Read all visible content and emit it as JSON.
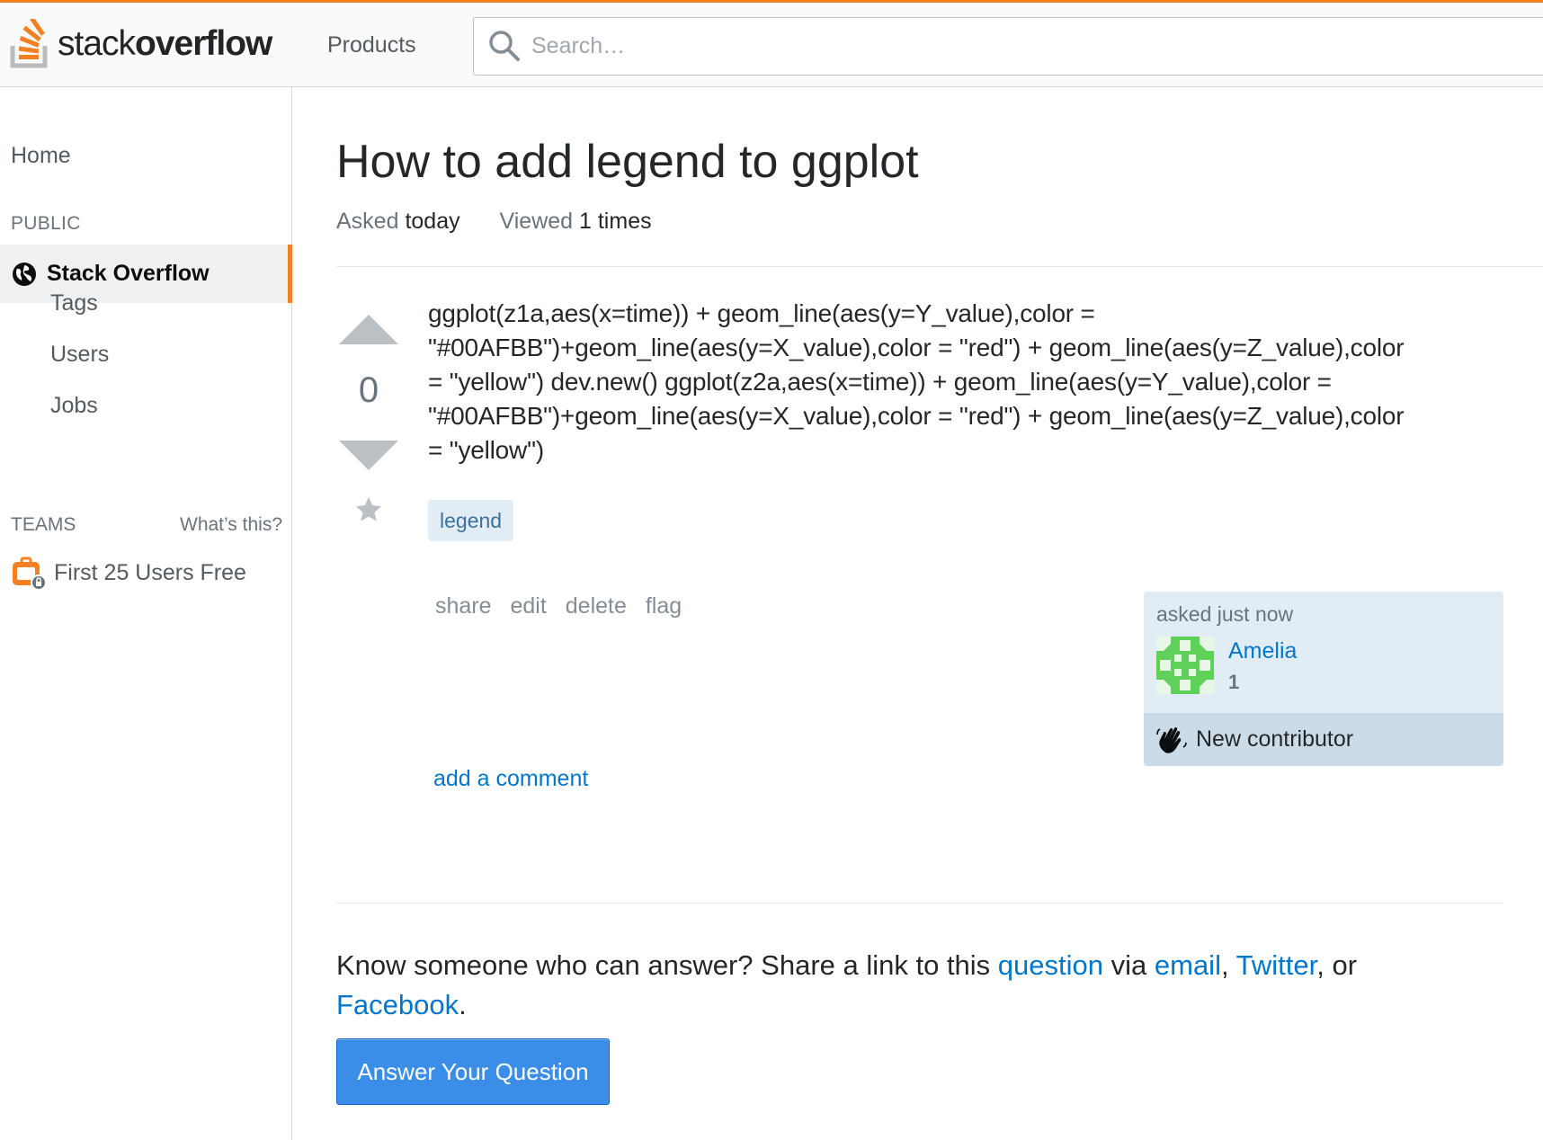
{
  "header": {
    "logo_light": "stack",
    "logo_bold": "overflow",
    "products_label": "Products",
    "search_placeholder": "Search…"
  },
  "sidebar": {
    "home": "Home",
    "public_heading": "PUBLIC",
    "stack_overflow": "Stack Overflow",
    "items": [
      "Tags",
      "Users",
      "Jobs"
    ],
    "teams_heading": "TEAMS",
    "whats_this": "What’s this?",
    "teams_offer": "First 25 Users Free"
  },
  "question": {
    "title": "How to add legend to ggplot",
    "asked_label": "Asked",
    "asked_value": "today",
    "viewed_label": "Viewed",
    "viewed_value": "1 times",
    "votes": "0",
    "body_lines": [
      "ggplot(z1a,aes(x=time)) + geom_line(aes(y=Y_value),color =",
      "\"#00AFBB\")+geom_line(aes(y=X_value),color = \"red\") + geom_line(aes(y=Z_value),color",
      "= \"yellow\") dev.new() ggplot(z2a,aes(x=time)) + geom_line(aes(y=Y_value),color =",
      "\"#00AFBB\")+geom_line(aes(y=X_value),color = \"red\") + geom_line(aes(y=Z_value),color",
      "= \"yellow\")"
    ],
    "tags": [
      "legend"
    ],
    "menu": {
      "share": "share",
      "edit": "edit",
      "delete": "delete",
      "flag": "flag"
    },
    "add_comment": "add a comment"
  },
  "owner": {
    "asked_time": "asked just now",
    "name": "Amelia",
    "reputation": "1",
    "badge": "New contributor"
  },
  "share_prompt": {
    "text_before": "Know someone who can answer? Share a link to this ",
    "question_link": "question",
    "text_via": " via ",
    "email_link": "email",
    "comma": ", ",
    "twitter_link": "Twitter",
    "text_or": ", or ",
    "facebook_link": "Facebook",
    "period": "."
  },
  "answer_button": "Answer Your Question",
  "colors": {
    "accent_orange": "#f48024",
    "link_blue": "#0077cc",
    "button_blue": "#3b8ee8",
    "tag_bg": "#e1ecf4",
    "avatar_green": "#5fd05a"
  }
}
